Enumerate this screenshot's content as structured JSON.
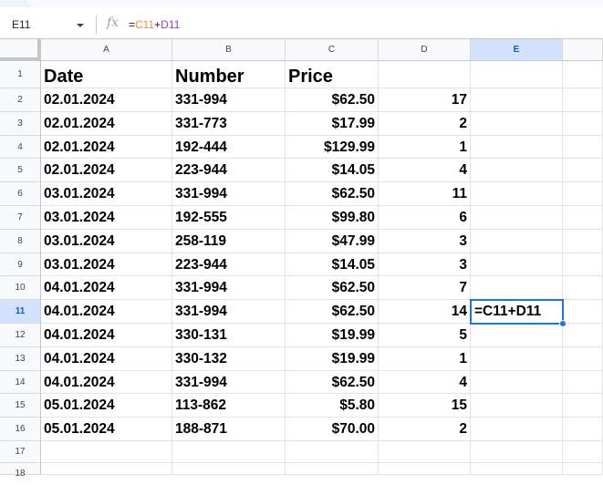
{
  "formula_bar": {
    "name_box": "E11",
    "fx_icon": "fx",
    "formula_prefix": "=",
    "formula_ref1": "C11",
    "formula_op": "+",
    "formula_ref2": "D11"
  },
  "columns": [
    "A",
    "B",
    "C",
    "D",
    "E"
  ],
  "selected_cell": {
    "column": "E",
    "row": 11,
    "value": "=C11+D11"
  },
  "header_row": [
    "Date",
    "Number",
    "Price",
    "",
    ""
  ],
  "rows": [
    [
      "02.01.2024",
      "331-994",
      "$62.50",
      "17"
    ],
    [
      "02.01.2024",
      "331-773",
      "$17.99",
      "2"
    ],
    [
      "02.01.2024",
      "192-444",
      "$129.99",
      "1"
    ],
    [
      "02.01.2024",
      "223-944",
      "$14.05",
      "4"
    ],
    [
      "03.01.2024",
      "331-994",
      "$62.50",
      "11"
    ],
    [
      "03.01.2024",
      "192-555",
      "$99.80",
      "6"
    ],
    [
      "03.01.2024",
      "258-119",
      "$47.99",
      "3"
    ],
    [
      "03.01.2024",
      "223-944",
      "$14.05",
      "3"
    ],
    [
      "04.01.2024",
      "331-994",
      "$62.50",
      "7"
    ],
    [
      "04.01.2024",
      "331-994",
      "$62.50",
      "14"
    ],
    [
      "04.01.2024",
      "330-131",
      "$19.99",
      "5"
    ],
    [
      "04.01.2024",
      "330-132",
      "$19.99",
      "1"
    ],
    [
      "04.01.2024",
      "331-994",
      "$62.50",
      "4"
    ],
    [
      "05.01.2024",
      "113-862",
      "$5.80",
      "15"
    ],
    [
      "05.01.2024",
      "188-871",
      "$70.00",
      "2"
    ]
  ],
  "row_numbers": [
    "1",
    "2",
    "3",
    "4",
    "5",
    "6",
    "7",
    "8",
    "9",
    "10",
    "11",
    "12",
    "13",
    "14",
    "15",
    "16",
    "17",
    "18"
  ]
}
